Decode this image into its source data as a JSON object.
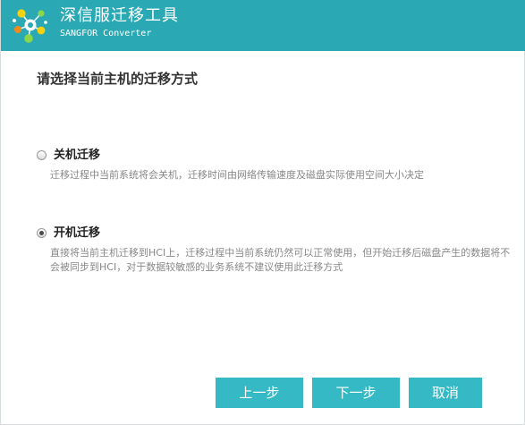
{
  "app": {
    "title": "深信服迁移工具",
    "subtitle": "SANGFOR Converter",
    "logo_icon": "molecule-logo-icon"
  },
  "colors": {
    "header": "#2aa8b4",
    "button": "#34b9c5"
  },
  "page": {
    "title": "请选择当前主机的迁移方式"
  },
  "options": [
    {
      "label": "关机迁移",
      "description": "迁移过程中当前系统将会关机，迁移时间由网络传输速度及磁盘实际使用空间大小决定",
      "checked": false
    },
    {
      "label": "开机迁移",
      "description": "直接将当前主机迁移到HCI上，迁移过程中当前系统仍然可以正常使用，但开始迁移后磁盘产生的数据将不会被同步到HCI，对于数据较敏感的业务系统不建议使用此迁移方式",
      "checked": true
    }
  ],
  "buttons": {
    "prev": "上一步",
    "next": "下一步",
    "cancel": "取消"
  }
}
